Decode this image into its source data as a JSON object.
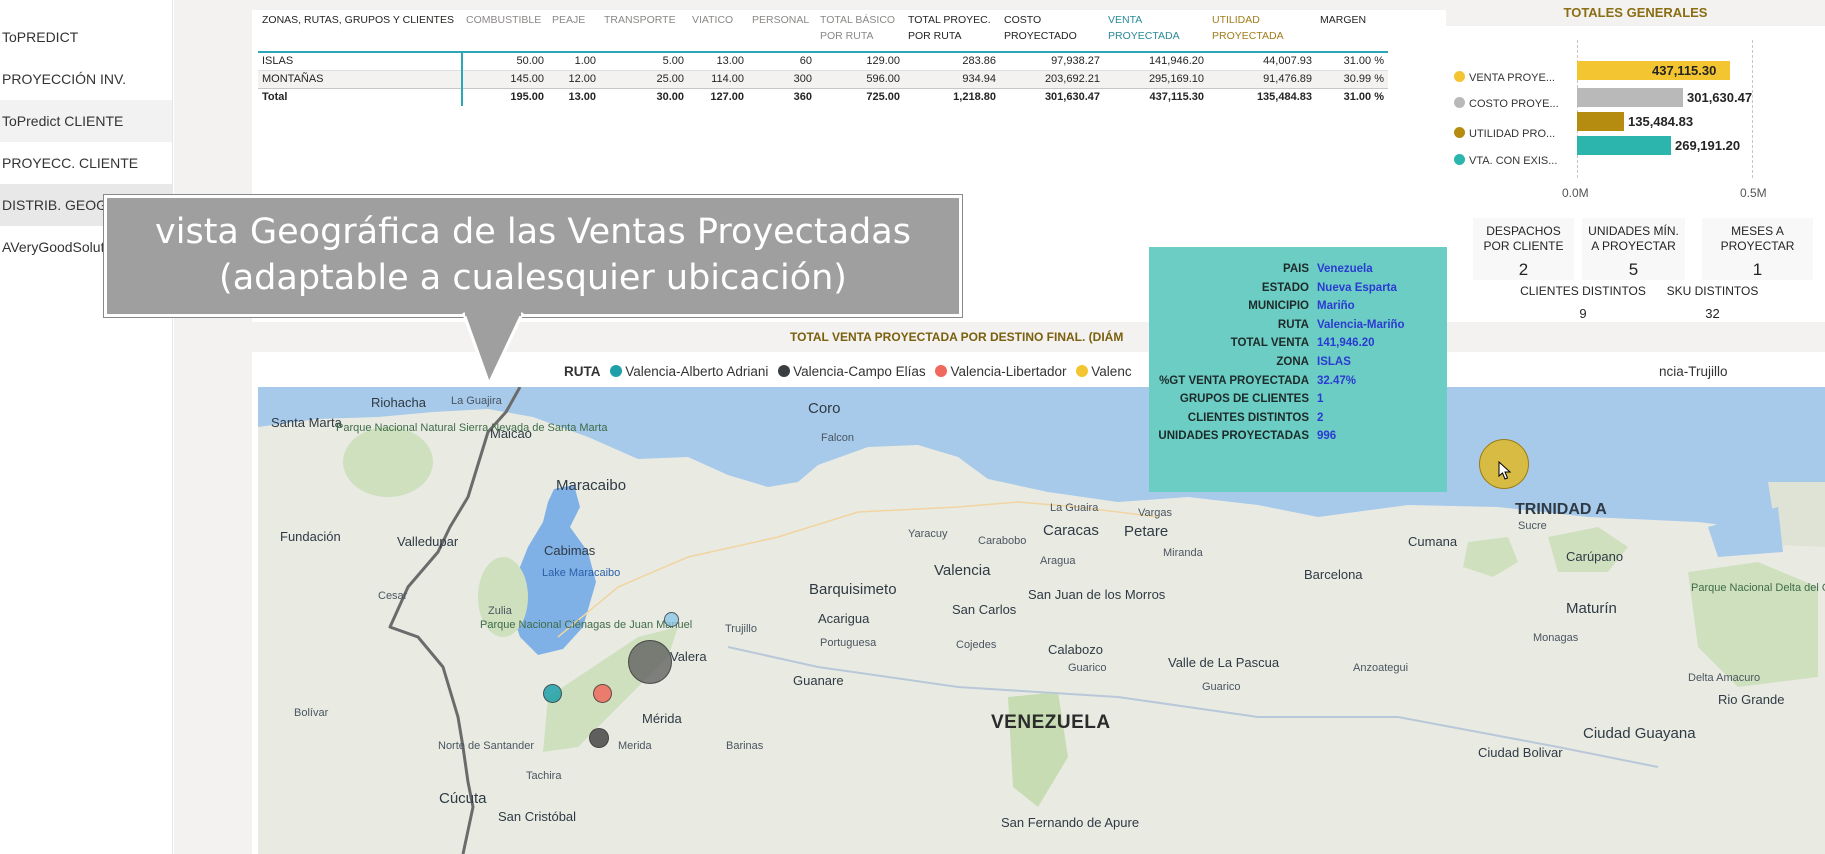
{
  "nav": {
    "items": [
      {
        "label": "ToPREDICT"
      },
      {
        "label": "PROYECCIÓN INV."
      },
      {
        "label": "ToPredict CLIENTE"
      },
      {
        "label": "PROYECC. CLIENTE"
      },
      {
        "label": "DISTRIB. GEOGRÁFICA"
      },
      {
        "label": "AVeryGoodSolution"
      }
    ]
  },
  "table": {
    "headers": [
      "ZONAS, RUTAS, GRUPOS Y CLIENTES",
      "COMBUSTIBLE",
      "PEAJE",
      "TRANSPORTE",
      "VIATICO",
      "PERSONAL",
      "TOTAL BÁSICO POR RUTA",
      "TOTAL PROYEC. POR RUTA",
      "COSTO PROYECTADO",
      "VENTA PROYECTADA",
      "UTILIDAD PROYECTADA",
      "MARGEN"
    ],
    "rows": [
      [
        "ISLAS",
        "50.00",
        "1.00",
        "5.00",
        "13.00",
        "60",
        "129.00",
        "283.86",
        "97,938.27",
        "141,946.20",
        "44,007.93",
        "31.00 %"
      ],
      [
        "MONTAÑAS",
        "145.00",
        "12.00",
        "25.00",
        "114.00",
        "300",
        "596.00",
        "934.94",
        "203,692.21",
        "295,169.10",
        "91,476.89",
        "30.99 %"
      ]
    ],
    "total": [
      "Total",
      "195.00",
      "13.00",
      "30.00",
      "127.00",
      "360",
      "725.00",
      "1,218.80",
      "301,630.47",
      "437,115.30",
      "135,484.83",
      "31.00 %"
    ]
  },
  "totales": {
    "title": "TOTALES GENERALES",
    "axis_min": "0.0M",
    "axis_max": "0.5M",
    "bars": [
      {
        "label": "VENTA PROYE...",
        "value": 437115.3,
        "display": "437,115.30",
        "color": "#f2c531"
      },
      {
        "label": "COSTO PROYE...",
        "value": 301630.47,
        "display": "301,630.47",
        "color": "#b9b9b9"
      },
      {
        "label": "UTILIDAD PRO...",
        "value": 135484.83,
        "display": "135,484.83",
        "color": "#b58c0f"
      },
      {
        "label": "VTA. CON EXIS...",
        "value": 269191.2,
        "display": "269,191.20",
        "color": "#2bb5ad"
      }
    ]
  },
  "kpis": {
    "despachos": {
      "title1": "DESPACHOS",
      "title2": "POR CLIENTE",
      "value": "2"
    },
    "unidades": {
      "title1": "UNIDADES MÍN.",
      "title2": "A PROYECTAR",
      "value": "5"
    },
    "meses": {
      "title1": "MESES A",
      "title2": "PROYECTAR",
      "value": "1"
    },
    "clientes": {
      "title": "CLIENTES DISTINTOS",
      "value": "9"
    },
    "sku": {
      "title": "SKU DISTINTOS",
      "value": "32"
    }
  },
  "map": {
    "title": "TOTAL VENTA PROYECTADA POR DESTINO FINAL.   (DIÁM",
    "legend_title": "RUTA",
    "legend": [
      {
        "label": "Valencia-Alberto Adriani",
        "color": "#1fa0a8"
      },
      {
        "label": "Valencia-Campo Elías",
        "color": "#3a3d42"
      },
      {
        "label": "Valencia-Libertador",
        "color": "#f0695e"
      },
      {
        "label": "Valenc",
        "color": "#f2c531"
      },
      {
        "label": "ncia-Trujillo",
        "color": ""
      }
    ],
    "places": {
      "riohacha": "Riohacha",
      "laguajira": "La Guajira",
      "santamarta": "Santa Marta",
      "maicao": "Maicao",
      "parque_sierra": "Parque Nacional Natural Sierra Nevada de Santa Marta",
      "coro": "Coro",
      "falcon": "Falcon",
      "maracaibo": "Maracaibo",
      "fundacion": "Fundación",
      "valledupar": "Valledupar",
      "cabimas": "Cabimas",
      "lake": "Lake Maracaibo",
      "cesar": "Cesar",
      "zulia": "Zulia",
      "parque_cienagas": "Parque Nacional Ciénagas de Juan Manuel",
      "trujillo": "Trujillo",
      "valera": "Valera",
      "bolivar_co": "Bolívar",
      "merida": "Mérida",
      "merida2": "Merida",
      "barinas": "Barinas",
      "nortesantander": "Norte de Santander",
      "tachira": "Tachira",
      "cucuta": "Cúcuta",
      "sancristobal": "San Cristóbal",
      "barquisimeto": "Barquisimeto",
      "acarigua": "Acarigua",
      "portuguesa": "Portuguesa",
      "guanare": "Guanare",
      "yaracuy": "Yaracuy",
      "carabobo": "Carabobo",
      "valencia": "Valencia",
      "sancarlos": "San Carlos",
      "cojedes": "Cojedes",
      "laguaira": "La Guaira",
      "vargas": "Vargas",
      "caracas": "Caracas",
      "petare": "Petare",
      "aragua": "Aragua",
      "miranda": "Miranda",
      "sanjuan": "San Juan de los Morros",
      "guarico": "Guarico",
      "calabozo": "Calabozo",
      "vallepascua": "Valle de La Pascua",
      "venezuela": "VENEZUELA",
      "sanfernando": "San Fernando de Apure",
      "anzoategui": "Anzoategui",
      "barcelona": "Barcelona",
      "cumana": "Cumana",
      "sucre": "Sucre",
      "carupano": "Carúpano",
      "maturin": "Maturín",
      "monagas": "Monagas",
      "parque_orinoco": "Parque Nacional Delta del Orinoco",
      "deltaamacuro": "Delta Amacuro",
      "riogrande": "Rio Grande",
      "ciudadguayana": "Ciudad Guayana",
      "ciudadbolivar": "Ciudad Bolivar",
      "trinidad": "TRINIDAD A TOBAGO",
      "nuevaesparta": "Nueva Esparta"
    }
  },
  "tooltip": {
    "rows": [
      {
        "k": "PAIS",
        "v": "Venezuela"
      },
      {
        "k": "ESTADO",
        "v": "Nueva Esparta"
      },
      {
        "k": "MUNICIPIO",
        "v": "Mariño"
      },
      {
        "k": "RUTA",
        "v": "Valencia-Mariño"
      },
      {
        "k": "TOTAL VENTA",
        "v": "141,946.20"
      },
      {
        "k": "ZONA",
        "v": "ISLAS"
      },
      {
        "k": "%GT VENTA PROYECTADA",
        "v": "32.47%"
      },
      {
        "k": "GRUPOS DE CLIENTES",
        "v": "1"
      },
      {
        "k": "CLIENTES DISTINTOS",
        "v": "2"
      },
      {
        "k": "UNIDADES PROYECTADAS",
        "v": "996"
      }
    ]
  },
  "callout": {
    "line1": "vista Geográfica de las Ventas Proyectadas",
    "line2": "(adaptable a cualesquier ubicación)"
  }
}
